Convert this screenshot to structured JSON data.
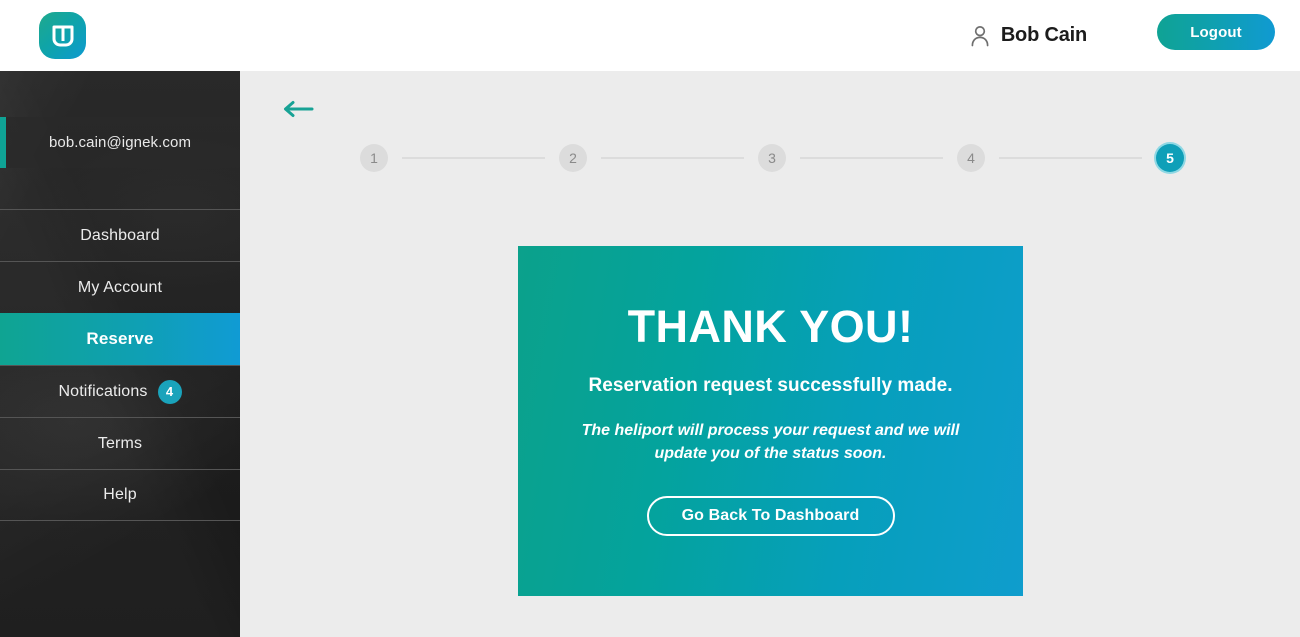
{
  "header": {
    "logo_icon": "w-logo-icon",
    "user_icon": "person-icon",
    "user_name": "Bob Cain",
    "logout_label": "Logout"
  },
  "sidebar": {
    "email": "bob.cain@ignek.com",
    "items": [
      {
        "label": "Dashboard",
        "active": false,
        "badge": null
      },
      {
        "label": "My Account",
        "active": false,
        "badge": null
      },
      {
        "label": "Reserve",
        "active": true,
        "badge": null
      },
      {
        "label": "Notifications",
        "active": false,
        "badge": "4"
      },
      {
        "label": "Terms",
        "active": false,
        "badge": null
      },
      {
        "label": "Help",
        "active": false,
        "badge": null
      }
    ]
  },
  "main": {
    "back_icon": "arrow-left-icon",
    "stepper": {
      "steps": [
        "1",
        "2",
        "3",
        "4",
        "5"
      ],
      "current": "5"
    },
    "card": {
      "title": "THANK YOU!",
      "subtitle": "Reservation request successfully made.",
      "note": "The heliport will process your request and we will update you of the status soon.",
      "button_label": "Go Back To Dashboard"
    }
  },
  "colors": {
    "accent_teal": "#0fa395",
    "accent_blue": "#109ad2",
    "badge": "#1aa3bb",
    "step_inactive": "#dcdcdc",
    "sidebar_bg": "#1e1e1e",
    "main_bg": "#ececec"
  }
}
